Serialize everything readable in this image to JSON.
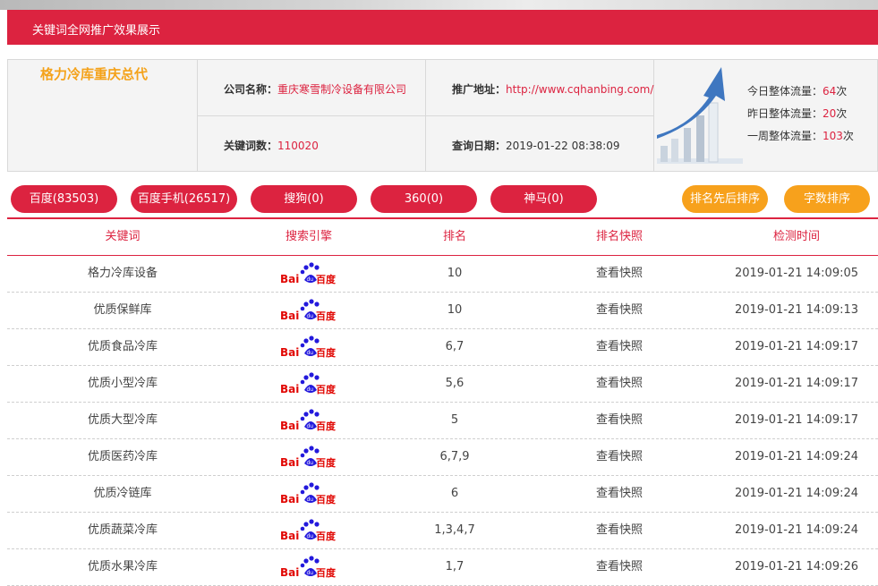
{
  "header": {
    "title": "关键词全网推广效果展示"
  },
  "info": {
    "brand": "格力冷库重庆总代",
    "company_label": "公司名称：",
    "company_value": "重庆寒雪制冷设备有限公司",
    "url_label": "推广地址：",
    "url_value": "http://www.cqhanbing.com/",
    "keyword_count_label": "关键词数：",
    "keyword_count_value": "110020",
    "query_date_label": "查询日期：",
    "query_date_value": "2019-01-22 08:38:09"
  },
  "traffic": {
    "today_label": "今日整体流量：",
    "today_value": "64",
    "today_unit": "次",
    "yesterday_label": "昨日整体流量：",
    "yesterday_value": "20",
    "yesterday_unit": "次",
    "week_label": "一周整体流量：",
    "week_value": "103",
    "week_unit": "次"
  },
  "engine_tabs": [
    "百度(83503)",
    "百度手机(26517)",
    "搜狗(0)",
    "360(0)",
    "神马(0)"
  ],
  "sort_buttons": [
    "排名先后排序",
    "字数排序"
  ],
  "table": {
    "headers": [
      "关键词",
      "搜索引擎",
      "排名",
      "排名快照",
      "检测时间"
    ],
    "engine_logo_text": {
      "bai": "Bai",
      "du": "du",
      "cn": "百度"
    },
    "rows": [
      {
        "keyword": "格力冷库设备",
        "rank": "10",
        "snapshot": "查看快照",
        "time": "2019-01-21 14:09:05"
      },
      {
        "keyword": "优质保鲜库",
        "rank": "10",
        "snapshot": "查看快照",
        "time": "2019-01-21 14:09:13"
      },
      {
        "keyword": "优质食品冷库",
        "rank": "6,7",
        "snapshot": "查看快照",
        "time": "2019-01-21 14:09:17"
      },
      {
        "keyword": "优质小型冷库",
        "rank": "5,6",
        "snapshot": "查看快照",
        "time": "2019-01-21 14:09:17"
      },
      {
        "keyword": "优质大型冷库",
        "rank": "5",
        "snapshot": "查看快照",
        "time": "2019-01-21 14:09:17"
      },
      {
        "keyword": "优质医药冷库",
        "rank": "6,7,9",
        "snapshot": "查看快照",
        "time": "2019-01-21 14:09:24"
      },
      {
        "keyword": "优质冷链库",
        "rank": "6",
        "snapshot": "查看快照",
        "time": "2019-01-21 14:09:24"
      },
      {
        "keyword": "优质蔬菜冷库",
        "rank": "1,3,4,7",
        "snapshot": "查看快照",
        "time": "2019-01-21 14:09:24"
      },
      {
        "keyword": "优质水果冷库",
        "rank": "1,7",
        "snapshot": "查看快照",
        "time": "2019-01-21 14:09:26"
      }
    ]
  },
  "colors": {
    "accent": "#dc2340",
    "orange": "#f7a11c",
    "brand": "#f4a21a"
  }
}
